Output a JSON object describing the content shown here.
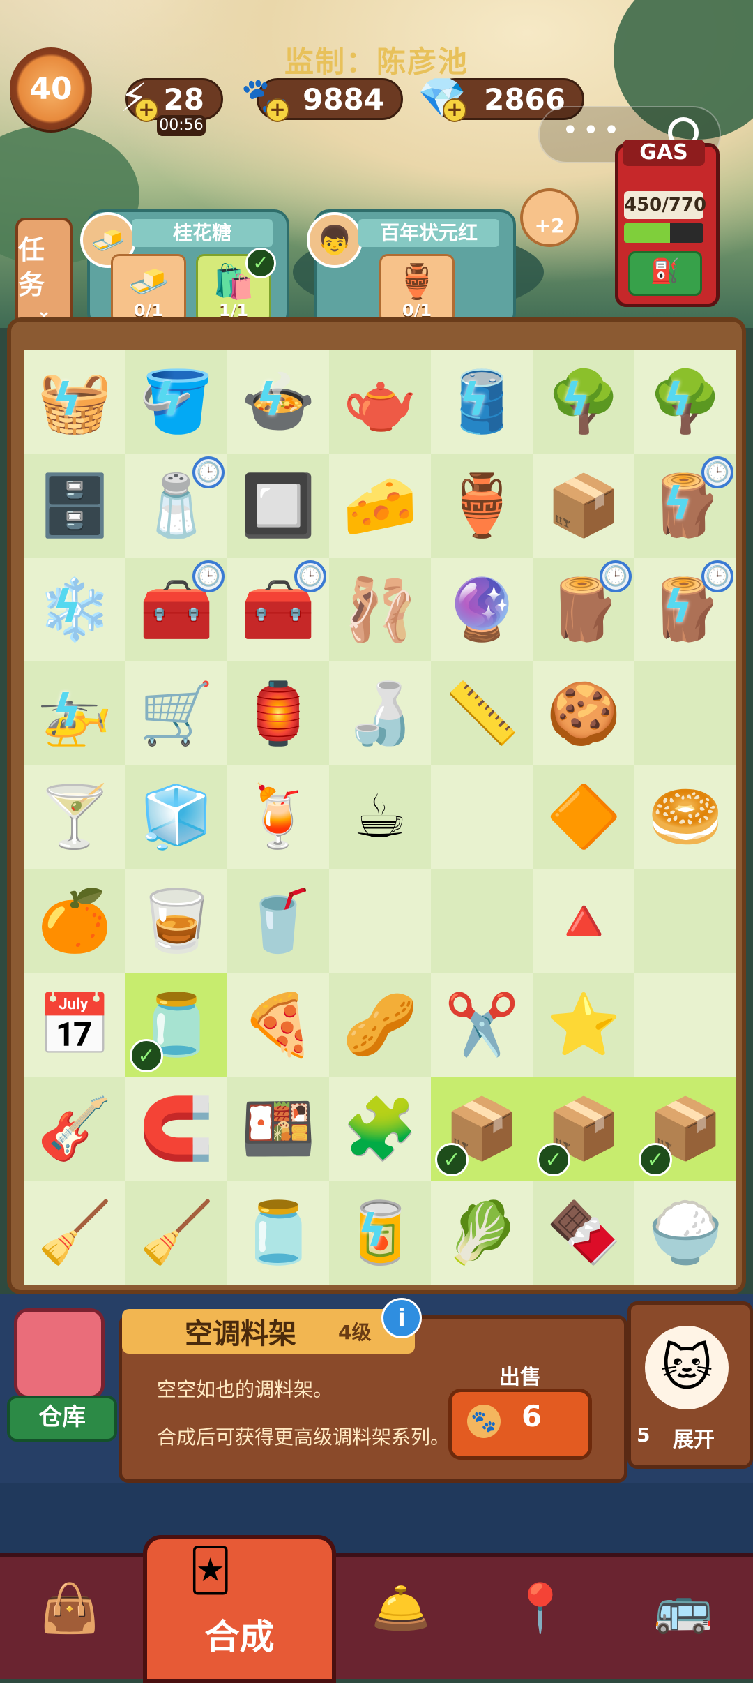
{
  "watermark": "监制：陈彦池",
  "player": {
    "level": "40"
  },
  "resources": {
    "energy": "28",
    "energy_timer": "00:56",
    "coins": "9884",
    "gems": "2866"
  },
  "gas": {
    "title": "GAS",
    "value": "450/770",
    "fill_fraction": 0.58
  },
  "task_button_label": "任务",
  "orders": [
    {
      "name": "桂花糖",
      "slots": [
        {
          "progress": "0/1",
          "done": false
        },
        {
          "progress": "1/1",
          "done": true
        }
      ]
    },
    {
      "name": "百年状元红",
      "slots": [
        {
          "progress": "0/1",
          "done": false
        }
      ]
    }
  ],
  "order_bonus": "+2",
  "board": {
    "rows": [
      [
        "🧺",
        "🪣",
        "🍲",
        "🫖",
        "🛢️",
        "🌳",
        "🌳"
      ],
      [
        "🗄️",
        "🧂",
        "🔲",
        "🧀",
        "🏺",
        "📦",
        "🪵"
      ],
      [
        "❄️",
        "🧰",
        "🧰",
        "🩰",
        "🔮",
        "🪵",
        "🪵"
      ],
      [
        "🚁",
        "🛒",
        "🏮",
        "🍶",
        "📏",
        "🍪",
        ""
      ],
      [
        "🍸",
        "🧊",
        "🍹",
        "☕",
        "",
        "🔶",
        "🥯"
      ],
      [
        "🍊",
        "🥃",
        "🥤",
        "",
        "",
        "🔺",
        ""
      ],
      [
        "📅",
        "🫙",
        "🍕",
        "🥜",
        "✂️",
        "⭐",
        ""
      ],
      [
        "🎸",
        "🧲",
        "🍱",
        "🧩",
        "📦",
        "📦",
        "📦"
      ],
      [
        "🧹",
        "🧹",
        "🫙",
        "🥫",
        "🥬",
        "🍫",
        "🍚"
      ]
    ]
  },
  "selected_item": {
    "name": "空调料架",
    "level": "4级",
    "desc1": "空空如也的调料架。",
    "desc2": "合成后可获得更高级调料架系列。",
    "sell_label": "出售",
    "sell_price": "6"
  },
  "warehouse_label": "仓库",
  "mascot": {
    "count": "5",
    "expand_label": "展开"
  },
  "nav": {
    "active_label": "合成"
  },
  "colors": {
    "accent": "#e75a36",
    "board": "#e8f2cf"
  }
}
